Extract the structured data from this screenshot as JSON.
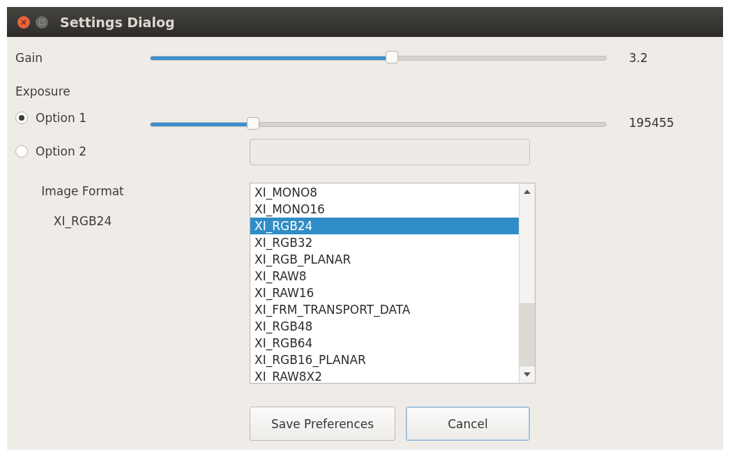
{
  "window": {
    "title": "Settings Dialog"
  },
  "gain": {
    "label": "Gain",
    "level": 0.53,
    "reading": "3.2"
  },
  "exposure": {
    "label": "Exposure",
    "options": [
      {
        "label": "Option 1",
        "selected": true
      },
      {
        "label": "Option 2",
        "selected": false
      }
    ],
    "slider": {
      "level": 0.226,
      "reading": "195455"
    }
  },
  "image_format": {
    "label": "Image Format",
    "current": "XI_RGB24",
    "items": [
      {
        "label": "XI_MONO8",
        "selected": false
      },
      {
        "label": "XI_MONO16",
        "selected": false
      },
      {
        "label": "XI_RGB24",
        "selected": true
      },
      {
        "label": "XI_RGB32",
        "selected": false
      },
      {
        "label": "XI_RGB_PLANAR",
        "selected": false
      },
      {
        "label": "XI_RAW8",
        "selected": false
      },
      {
        "label": "XI_RAW16",
        "selected": false
      },
      {
        "label": "XI_FRM_TRANSPORT_DATA",
        "selected": false
      },
      {
        "label": "XI_RGB48",
        "selected": false
      },
      {
        "label": "XI_RGB64",
        "selected": false
      },
      {
        "label": "XI_RGB16_PLANAR",
        "selected": false
      },
      {
        "label": "XI_RAW8X2",
        "selected": false
      }
    ]
  },
  "buttons": [
    {
      "label": "Save Preferences",
      "focused": false
    },
    {
      "label": "Cancel",
      "focused": true
    }
  ]
}
